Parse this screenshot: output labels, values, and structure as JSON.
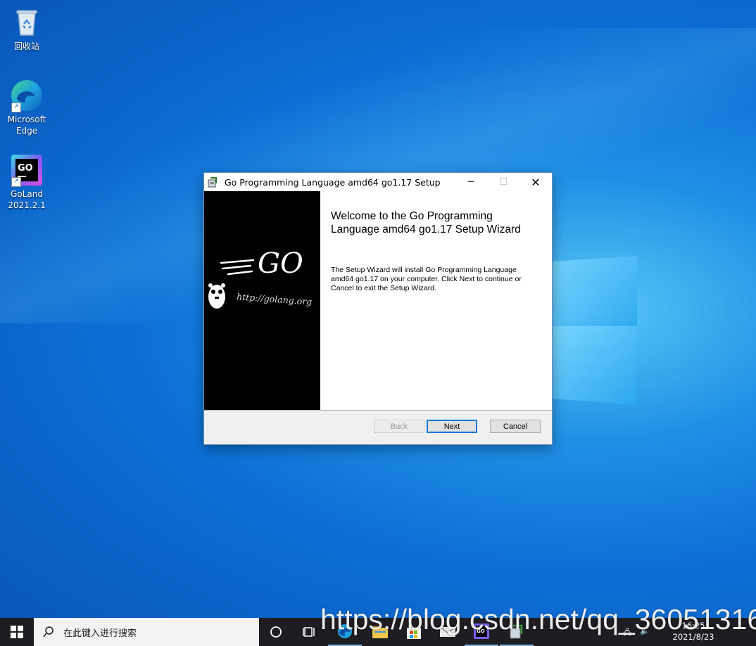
{
  "desktop": {
    "icons": [
      {
        "label": "回收站",
        "icon": "recycle-bin-icon"
      },
      {
        "label": "Microsoft Edge",
        "icon": "edge-icon"
      },
      {
        "label": "GoLand 2021.2.1",
        "icon": "goland-icon"
      }
    ]
  },
  "dialog": {
    "title": "Go Programming Language amd64 go1.17 Setup",
    "heading": "Welcome to the Go Programming Language amd64 go1.17 Setup Wizard",
    "body": "The Setup Wizard will install Go Programming Language amd64 go1.17 on your computer. Click Next to continue or Cancel to exit the Setup Wizard.",
    "banner": {
      "logo": "GO",
      "url": "http://golang.org"
    },
    "buttons": {
      "back": "Back",
      "next": "Next",
      "cancel": "Cancel"
    }
  },
  "taskbar": {
    "search_placeholder": "在此键入进行搜索",
    "apps": [
      "cortana-icon",
      "task-view-icon",
      "edge-icon",
      "file-explorer-icon",
      "store-icon",
      "mail-icon",
      "goland-icon",
      "installer-icon"
    ],
    "clock_time": "16:25",
    "clock_date": "2021/8/23"
  },
  "watermark": "https://blog.csdn.net/qq_36051316",
  "colors": {
    "accent": "#0078d7",
    "taskbar": "#1e1e22"
  }
}
